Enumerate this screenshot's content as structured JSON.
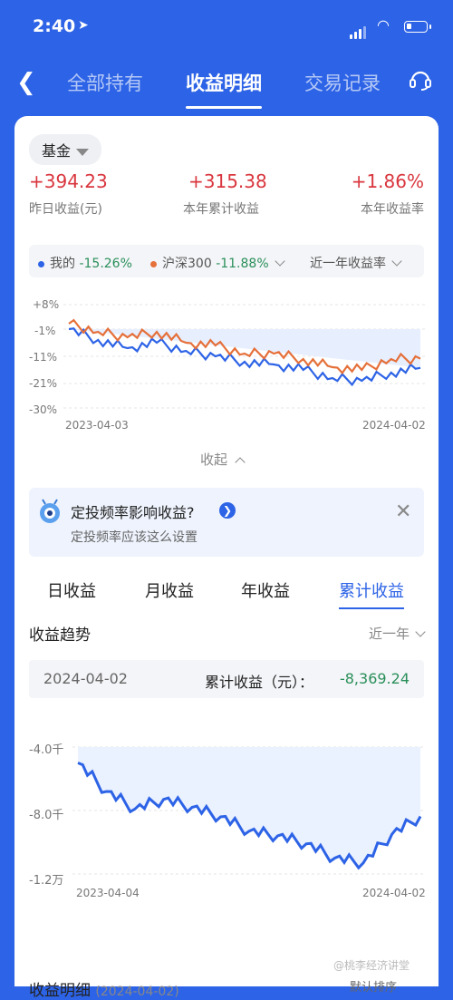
{
  "status": {
    "time": "2:40"
  },
  "nav": {
    "tabs": [
      "全部持有",
      "收益明细",
      "交易记录"
    ],
    "active": 1
  },
  "fund_filter": {
    "label": "基金"
  },
  "stats": [
    {
      "value": "+394.23",
      "label": "昨日收益(元)"
    },
    {
      "value": "+315.38",
      "label": "本年累计收益"
    },
    {
      "value": "+1.86%",
      "label": "本年收益率"
    }
  ],
  "compare": {
    "mine_label": "我的",
    "mine_value": "-15.26%",
    "mine_color": "#2d63e6",
    "bench_label": "沪深300",
    "bench_value": "-11.88%",
    "bench_color": "#e5703a",
    "period": "近一年收益率"
  },
  "chart1": {
    "yticks": [
      "+8%",
      "-1%",
      "-11%",
      "-21%",
      "-30%"
    ],
    "x_start": "2023-04-03",
    "x_end": "2024-04-02"
  },
  "collapse_label": "收起",
  "banner": {
    "title": "定投频率影响收益?",
    "subtitle": "定投频率应该这么设置"
  },
  "period_tabs": [
    "日收益",
    "月收益",
    "年收益",
    "累计收益"
  ],
  "period_active": 3,
  "trend": {
    "title": "收益趋势",
    "range": "近一年"
  },
  "tooltip": {
    "date": "2024-04-02",
    "label": "累计收益（元）：",
    "value": "-8,369.24"
  },
  "chart2": {
    "yticks": [
      "-4.0千",
      "-8.0千",
      "-1.2万"
    ],
    "x_start": "2023-04-04",
    "x_end": "2024-04-02"
  },
  "footer": {
    "title": "收益明细",
    "date": "(2024-04-02)",
    "sort": "默认排序",
    "watermark": "@桃李经济讲堂"
  },
  "chart_data": [
    {
      "type": "line",
      "x": [
        "2023-04-03",
        "2023-05",
        "2023-06",
        "2023-07",
        "2023-08",
        "2023-09",
        "2023-10",
        "2023-11",
        "2023-12",
        "2024-01",
        "2024-02",
        "2024-03",
        "2024-04-02"
      ],
      "series": [
        {
          "name": "我的",
          "values": [
            -1,
            -5,
            -8,
            -6,
            -9,
            -11,
            -13,
            -14,
            -16,
            -19,
            -20,
            -17,
            -15.26
          ]
        },
        {
          "name": "沪深300",
          "values": [
            1,
            -2,
            -4,
            -2,
            -6,
            -7,
            -10,
            -10,
            -12,
            -15,
            -16,
            -12,
            -11.88
          ]
        }
      ],
      "ylim": [
        -30,
        8
      ]
    },
    {
      "type": "area",
      "x": [
        "2023-04-04",
        "2023-05",
        "2023-06",
        "2023-07",
        "2023-08",
        "2023-09",
        "2023-10",
        "2023-11",
        "2023-12",
        "2024-01",
        "2024-02",
        "2024-03",
        "2024-04-02"
      ],
      "series": [
        {
          "name": "累计收益",
          "values": [
            -5000,
            -6800,
            -7900,
            -7300,
            -7800,
            -8400,
            -9300,
            -9600,
            -10100,
            -11000,
            -11300,
            -9500,
            -8369.24
          ]
        }
      ],
      "ylim": [
        -12000,
        -4000
      ]
    }
  ]
}
